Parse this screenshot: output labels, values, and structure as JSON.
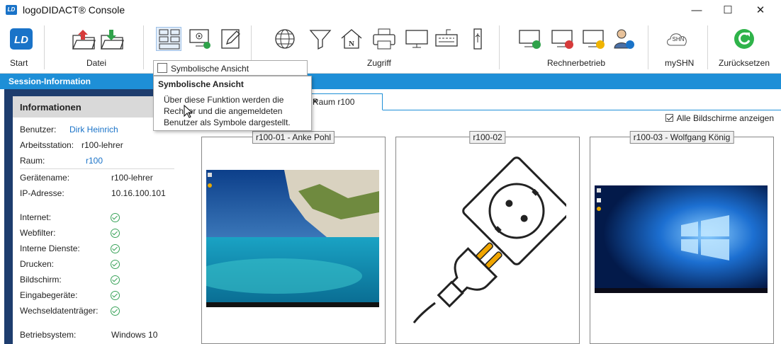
{
  "window": {
    "title": "logoDIDACT® Console",
    "logo": "LD",
    "controls": [
      "—",
      "☐",
      "✕"
    ]
  },
  "ribbon": {
    "groups": {
      "start": "Start",
      "datei": "Datei",
      "zugriff": "Zugriff",
      "rechnerbetrieb": "Rechnerbetrieb",
      "myshn": "mySHN",
      "zuruecksetzen": "Zurücksetzen"
    },
    "start_icon_text": "LD",
    "myshn_icon_text": "SHN"
  },
  "tooltip": {
    "header": "Symbolische Ansicht",
    "title": "Symbolische Ansicht",
    "body": "Über diese Funktion werden die Rechner und die angemeldeten Benutzer als Symbole dargestellt."
  },
  "session": {
    "band_title": "Session-Information",
    "panel_title": "Informationen",
    "benutzer_label": "Benutzer:",
    "benutzer_value": "Dirk Heinrich",
    "arbeitsstation_label": "Arbeitsstation:",
    "arbeitsstation_value": "r100-lehrer",
    "raum_label": "Raum:",
    "raum_value": "r100",
    "geraetename_label": "Gerätename:",
    "geraetename_value": "r100-lehrer",
    "ip_label": "IP-Adresse:",
    "ip_value": "10.16.100.101",
    "services": [
      {
        "label": "Internet:",
        "status": "ok"
      },
      {
        "label": "Webfilter:",
        "status": "ok"
      },
      {
        "label": "Interne Dienste:",
        "status": "ok"
      },
      {
        "label": "Drucken:",
        "status": "ok"
      },
      {
        "label": "Bildschirm:",
        "status": "ok"
      },
      {
        "label": "Eingabegeräte:",
        "status": "ok"
      },
      {
        "label": "Wechseldatenträger:",
        "status": "ok"
      }
    ],
    "os_label": "Betriebsystem:",
    "os_value": "Windows 10"
  },
  "main": {
    "tab_label": "Raum r100",
    "tab_close": "×",
    "show_all_label": "Alle Bildschirme anzeigen",
    "show_all_checked": true,
    "computers": [
      {
        "label": "r100-01 - Anke Pohl",
        "view": "beach-desktop"
      },
      {
        "label": "r100-02",
        "view": "powered-off"
      },
      {
        "label": "r100-03 - Wolfgang König",
        "view": "windows-desktop"
      }
    ]
  },
  "colors": {
    "accent": "#1e8fd7",
    "panel_dark": "#1e3d6e",
    "ok_green": "#3aa35a",
    "reset_green": "#2fb34a"
  }
}
